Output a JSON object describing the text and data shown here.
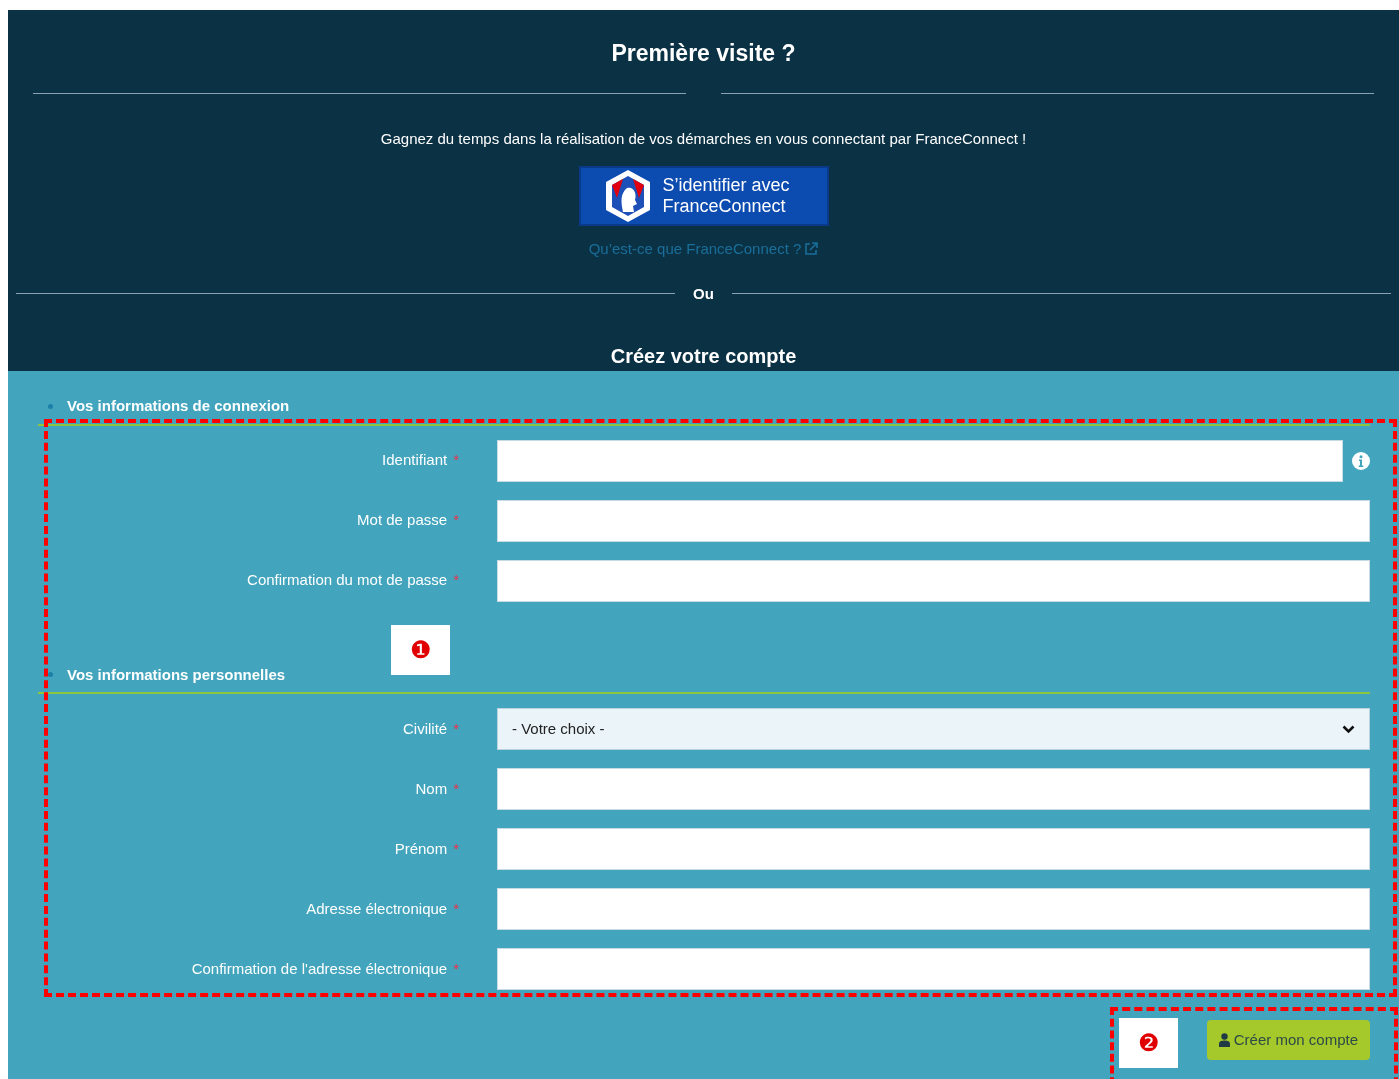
{
  "header": {
    "title": "Première visite ?",
    "intro": "Gagnez du temps dans la réalisation de vos démarches en vous connectant par FranceConnect !",
    "fc_button": [
      "S’identifier avec",
      "FranceConnect"
    ],
    "fc_link": "Qu’est-ce que FranceConnect ?",
    "separator": "Ou",
    "subtitle": "Créez votre compte"
  },
  "sections": [
    {
      "title": "Vos informations de connexion",
      "fields": [
        {
          "kind": "text",
          "label": "Identifiant",
          "mark": "*",
          "info": true
        },
        {
          "kind": "text",
          "label": "Mot de passe",
          "mark": "*",
          "info": false
        },
        {
          "kind": "text",
          "label": "Confirmation du mot de passe",
          "mark": "*",
          "info": false
        }
      ]
    },
    {
      "title": "Vos informations personnelles",
      "fields": [
        {
          "kind": "select",
          "label": "Civilité",
          "mark": "*",
          "value": "- Votre choix -",
          "info": false
        },
        {
          "kind": "text",
          "label": "Nom",
          "mark": "*",
          "info": false
        },
        {
          "kind": "text",
          "label": "Prénom",
          "mark": "*",
          "info": false
        },
        {
          "kind": "text",
          "label": "Adresse électronique",
          "mark": "*",
          "info": false
        },
        {
          "kind": "text",
          "label": "Confirmation de l'adresse électronique",
          "mark": "*",
          "info": false
        }
      ]
    }
  ],
  "submit": "Créer mon compte",
  "annotations": [
    {
      "label": "❶"
    },
    {
      "label": "❷"
    }
  ]
}
